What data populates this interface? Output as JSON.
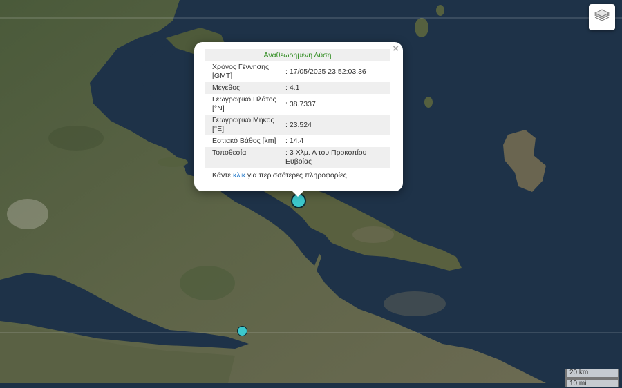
{
  "popup": {
    "title": "Αναθεωρημένη Λύση",
    "close_symbol": "×",
    "rows": [
      {
        "label": "Χρόνος Γέννησης [GMT]",
        "value": ": 17/05/2025 23:52:03.36"
      },
      {
        "label": "Μέγεθος",
        "value": ": 4.1"
      },
      {
        "label": "Γεωγραφικό Πλάτος [°N]",
        "value": ": 38.7337"
      },
      {
        "label": "Γεωγραφικό Μήκος [°E]",
        "value": ": 23.524"
      },
      {
        "label": "Εστιακό Βάθος [km]",
        "value": ": 14.4"
      },
      {
        "label": "Τοποθεσία",
        "value": ": 3 Χλμ. Α του Προκοπίου Ευβοίας"
      }
    ],
    "more_prefix": "Κάντε",
    "more_link": "κλικ",
    "more_suffix": "για περισσότερες πληροφορίες"
  },
  "scale": {
    "km": "20 km",
    "mi": "10 mi"
  },
  "icons": {
    "layers": "layers-icon",
    "close": "close-icon"
  },
  "colors": {
    "marker": "#3cc8cc",
    "title": "#2e8b1e",
    "link": "#1a73c7",
    "sea": "#1d3146"
  }
}
